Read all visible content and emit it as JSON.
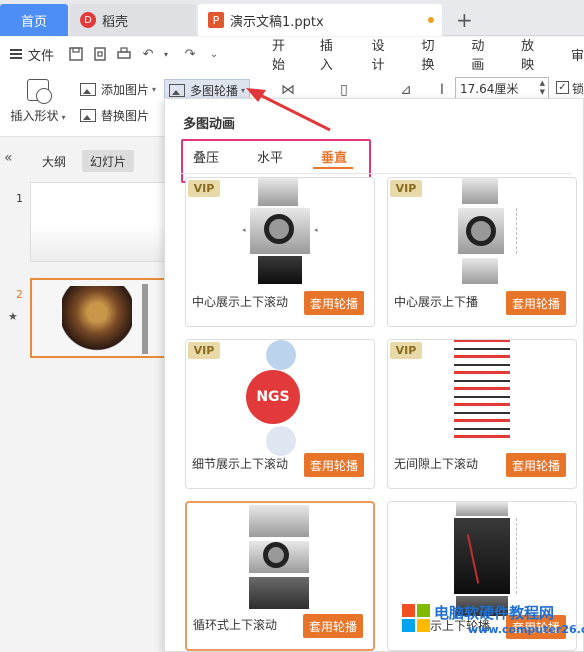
{
  "titlebar": {
    "home_tab": "首页",
    "daoke_tab": "稻壳",
    "daoke_logo": "D",
    "doc_tab": "演示文稿1.pptx",
    "doc_logo": "P",
    "new_tab": "+"
  },
  "menubar": {
    "file": "文件",
    "tabs": [
      "开始",
      "插入",
      "设计",
      "切换",
      "动画",
      "放映",
      "审"
    ]
  },
  "toolbar": {
    "insert_shape": "插入形状",
    "add_picture": "添加图片",
    "replace_picture": "替换图片",
    "multi_carousel": "多图轮播",
    "width_value": "17.64厘米",
    "lock_label": "锁"
  },
  "left_panel": {
    "outline_tab": "大纲",
    "slides_tab": "幻灯片",
    "slides": [
      {
        "number": "1"
      },
      {
        "number": "2"
      }
    ]
  },
  "popup": {
    "title": "多图动画",
    "tabs": [
      {
        "label": "叠压",
        "active": false
      },
      {
        "label": "水平",
        "active": false
      },
      {
        "label": "垂直",
        "active": true
      }
    ],
    "cards": [
      {
        "label": "中心展示上下滚动",
        "button": "套用轮播",
        "vip": "VIP"
      },
      {
        "label": "中心展示上下播",
        "button": "套用轮播",
        "vip": "VIP"
      },
      {
        "label": "细节展示上下滚动",
        "button": "套用轮播",
        "vip": "VIP"
      },
      {
        "label": "无间隙上下滚动",
        "button": "套用轮播",
        "vip": "VIP"
      },
      {
        "label": "循环式上下滚动",
        "button": "套用轮播"
      },
      {
        "label": "示上下轮播",
        "button": "套用轮播"
      }
    ]
  },
  "watermark": {
    "text": "电脑软硬件教程网",
    "url": "www.computer26.com"
  },
  "colors": {
    "accent": "#e8742a",
    "highlight_box": "#e0377a",
    "arrow": "#e0373a",
    "home_tab": "#4c8df6"
  }
}
